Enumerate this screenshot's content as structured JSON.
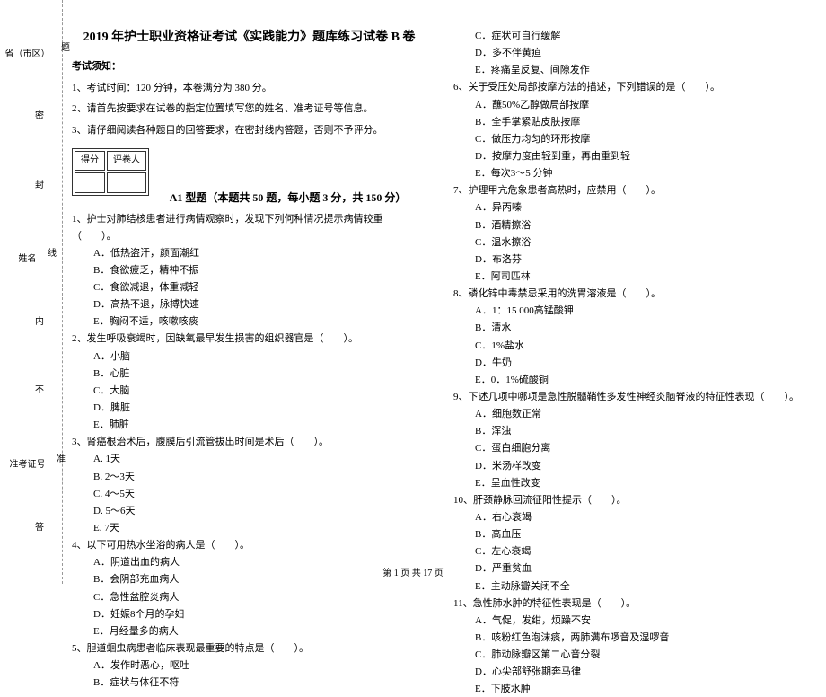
{
  "title": "2019 年护士职业资格证考试《实践能力》题库练习试卷 B 卷",
  "binding": {
    "seal": "密",
    "cut": "封",
    "line": "线",
    "inner": "内",
    "no": "不",
    "allow": "准",
    "ans": "答",
    "ques": "题",
    "province": "省（市区）",
    "name": "姓名",
    "ticket": "准考证号"
  },
  "notice_header": "考试须知：",
  "instructions": [
    "1、考试时间：120 分钟，本卷满分为 380 分。",
    "2、请首先按要求在试卷的指定位置填写您的姓名、准考证号等信息。",
    "3、请仔细阅读各种题目的回答要求，在密封线内答题，否则不予评分。"
  ],
  "score_table": {
    "score": "得分",
    "grader": "评卷人"
  },
  "section_a1": "A1 型题（本题共 50 题，每小题 3 分，共 150 分）",
  "left_questions": [
    {
      "stem": "1、护士对肺结核患者进行病情观察时，发现下列何种情况提示病情较重（　　）。",
      "opts": [
        "A．低热盗汗，颜面潮红",
        "B．食欲疲乏，精神不振",
        "C．食欲减退，体重减轻",
        "D．高热不退，脉搏快速",
        "E．胸闷不适，咳嗽咳痰"
      ]
    },
    {
      "stem": "2、发生呼吸衰竭时，因缺氧最早发生损害的组织器官是（　　）。",
      "opts": [
        "A．小脑",
        "B．心脏",
        "C．大脑",
        "D．脾脏",
        "E．肺脏"
      ]
    },
    {
      "stem": "3、肾癌根治术后，腹膜后引流管拔出时间是术后（　　）。",
      "opts": [
        "A. 1天",
        "B. 2～3天",
        "C. 4～5天",
        "D. 5～6天",
        "E. 7天"
      ]
    },
    {
      "stem": "4、以下可用热水坐浴的病人是（　　）。",
      "opts": [
        "A．阴道出血的病人",
        "B．会阴部充血病人",
        "C．急性盆腔炎病人",
        "D．妊娠8个月的孕妇",
        "E．月经量多的病人"
      ]
    },
    {
      "stem": "5、胆道蛔虫病患者临床表现最重要的特点是（　　）。",
      "opts": [
        "A．发作时恶心，呕吐",
        "B．症状与体征不符"
      ]
    }
  ],
  "right_top_opts": [
    "C．症状可自行缓解",
    "D．多不伴黄疸",
    "E．疼痛呈反复、间隙发作"
  ],
  "right_questions": [
    {
      "stem": "6、关于受压处局部按摩方法的描述，下列错误的是（　　）。",
      "opts": [
        "A．蘸50%乙醇做局部按摩",
        "B．全手掌紧贴皮肤按摩",
        "C．做压力均匀的环形按摩",
        "D．按摩力度由轻到重，再由重到轻",
        "E．每次3～5 分钟"
      ]
    },
    {
      "stem": "7、护理甲亢危象患者高热时，应禁用（　　）。",
      "opts": [
        "A．异丙嗪",
        "B．酒精擦浴",
        "C．温水擦浴",
        "D．布洛芬",
        "E．阿司匹林"
      ]
    },
    {
      "stem": "8、磷化锌中毒禁忌采用的洗胃溶液是（　　）。",
      "opts": [
        "A．1：15 000高锰酸钾",
        "B．清水",
        "C．1%盐水",
        "D．牛奶",
        "E．0．1%硫酸铜"
      ]
    },
    {
      "stem": "9、下述几项中哪项是急性脱髓鞘性多发性神经炎脑脊液的特征性表现（　　）。",
      "opts": [
        "A．细胞数正常",
        "B．浑浊",
        "C．蛋白细胞分离",
        "D．米汤样改变",
        "E．呈血性改变"
      ]
    },
    {
      "stem": "10、肝颈静脉回流征阳性提示（　　）。",
      "opts": [
        "A．右心衰竭",
        "B．高血压",
        "C．左心衰竭",
        "D．严重贫血",
        "E．主动脉瓣关闭不全"
      ]
    },
    {
      "stem": "11、急性肺水肿的特征性表现是（　　）。",
      "opts": [
        "A．气促，发绀，烦躁不安",
        "B．咳粉红色泡沫痰，两肺满布啰音及湿啰音",
        "C．肺动脉瓣区第二心音分裂",
        "D．心尖部舒张期奔马律",
        "E．下肢水肿"
      ]
    }
  ],
  "footer": "第 1 页 共 17 页"
}
